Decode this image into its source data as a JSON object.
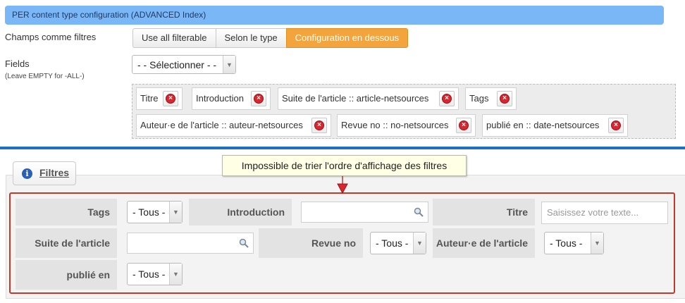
{
  "header": {
    "title": "PER content type configuration (ADVANCED Index)"
  },
  "config": {
    "champs_label": "Champs comme filtres",
    "modes": [
      "Use all filterable",
      "Selon le type",
      "Configuration en dessous"
    ],
    "fields_label": "Fields",
    "fields_hint": "(Leave EMPTY for -ALL-)",
    "fields_select": "- - Sélectionner - -",
    "selected_fields": [
      "Titre",
      "Introduction",
      "Suite de l'article :: article-netsources",
      "Tags",
      "Auteur·e de l'article :: auteur-netsources",
      "Revue no :: no-netsources",
      "publié en :: date-netsources"
    ]
  },
  "filters": {
    "tab_label": "Filtres",
    "callout": "Impossible de trier l'ordre d'affichage des filtres",
    "labels": {
      "tags": "Tags",
      "introduction": "Introduction",
      "titre": "Titre",
      "suite": "Suite de l'article",
      "revue": "Revue no",
      "auteur": "Auteur·e de l'article",
      "publie": "publié en"
    },
    "all_option": "- Tous -",
    "titre_placeholder": "Saisissez votre texte..."
  },
  "colors": {
    "header_bg": "#7ab7f7",
    "active_mode": "#f4a43c",
    "divider": "#1d6fc2",
    "highlight_frame": "#c0392b"
  }
}
